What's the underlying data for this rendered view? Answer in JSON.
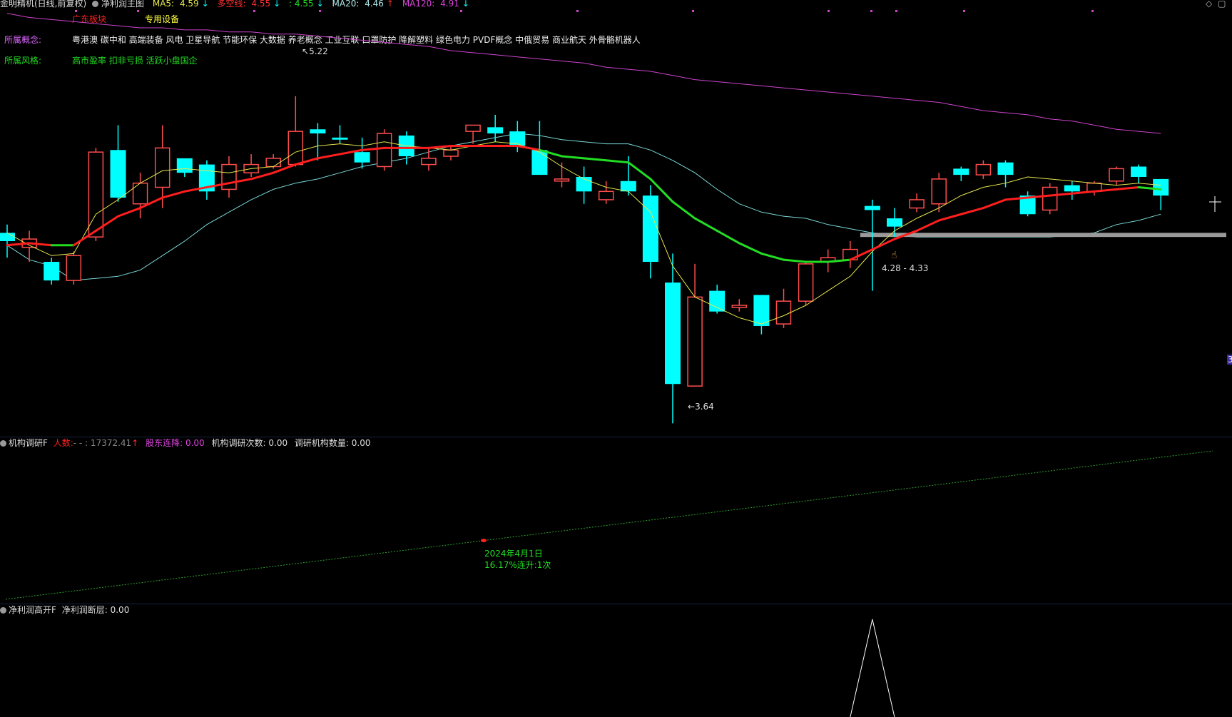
{
  "header": {
    "stock_name": "金明精机(日线,前复权)",
    "indicator": "净利润主图",
    "ma5_label": "MA5:",
    "ma5_value": "4.59",
    "ma5_arrow": "↓",
    "duo_label": "多空线:",
    "duo_value": "4.55",
    "duo_arrow": "↓",
    "colon_value": ": 4.55",
    "colon_arrow": "↓",
    "ma20_label": "MA20:",
    "ma20_value": "4.46",
    "ma20_arrow": "↑",
    "ma120_label": "MA120:",
    "ma120_value": "4.91",
    "ma120_arrow": "↓"
  },
  "info": {
    "region_tag": "广东板块",
    "industry_tag": "专用设备",
    "concept_label": "所属概念:",
    "concepts": "粤港澳  碳中和  高端装备  风电  卫星导航  节能环保  大数据  养老概念  工业互联  口罩防护  降解塑料  绿色电力  PVDF概念  中俄贸易  商业航天  外骨骼机器人",
    "style_label": "所属风格:",
    "styles": "高市盈率  扣非亏损  活跃小盘国企"
  },
  "colors": {
    "up": "#ff4d4d",
    "down": "#00ffff",
    "ma5": "#e6e64d",
    "duo_red": "#ff1e1e",
    "duo_green": "#22dd22",
    "ma20": "#7ad6d6",
    "ma120": "#cc44cc"
  },
  "main_chart_annotations": {
    "high": "5.22",
    "low": "3.64",
    "range": "4.28 - 4.33",
    "edge_marker": "3"
  },
  "panel2": {
    "name": "机构调研F",
    "p1_label": "人数:",
    "p1_value": "- - : 17372.41",
    "p1_arrow": "↑",
    "p2_label": "股东连降:",
    "p2_value": "0.00",
    "p3_label": "机构调研次数:",
    "p3_value": "0.00",
    "p4_label": "调研机构数量:",
    "p4_value": "0.00",
    "event_date": "2024年4月1日",
    "event_text": "16.17%连升:1次"
  },
  "panel3": {
    "name": "净利润高开F",
    "p1_label": "净利润断层:",
    "p1_value": "0.00"
  },
  "chart_data": {
    "type": "candlestick",
    "candles": [
      [
        4.56,
        4.52,
        4.6,
        4.44
      ],
      [
        4.49,
        4.53,
        4.57,
        4.42
      ],
      [
        4.42,
        4.33,
        4.44,
        4.31
      ],
      [
        4.33,
        4.45,
        4.47,
        4.31
      ],
      [
        4.54,
        4.95,
        4.97,
        4.52
      ],
      [
        4.96,
        4.73,
        5.08,
        4.71
      ],
      [
        4.7,
        4.8,
        4.85,
        4.63
      ],
      [
        4.78,
        4.97,
        5.08,
        4.68
      ],
      [
        4.92,
        4.85,
        4.9,
        4.83
      ],
      [
        4.89,
        4.76,
        4.91,
        4.72
      ],
      [
        4.77,
        4.89,
        4.93,
        4.73
      ],
      [
        4.85,
        4.89,
        4.94,
        4.83
      ],
      [
        4.88,
        4.92,
        4.94,
        4.87
      ],
      [
        4.89,
        5.05,
        5.22,
        4.88
      ],
      [
        5.06,
        5.04,
        5.09,
        4.91
      ],
      [
        5.02,
        5.01,
        5.08,
        4.99
      ],
      [
        4.95,
        4.9,
        5.02,
        4.87
      ],
      [
        4.88,
        5.04,
        5.06,
        4.86
      ],
      [
        5.03,
        4.93,
        5.05,
        4.89
      ],
      [
        4.89,
        4.92,
        4.97,
        4.86
      ],
      [
        4.93,
        4.96,
        4.98,
        4.91
      ],
      [
        5.05,
        5.08,
        5.07,
        4.99
      ],
      [
        5.07,
        5.04,
        5.13,
        5.0
      ],
      [
        5.05,
        4.98,
        5.1,
        4.95
      ],
      [
        4.96,
        4.84,
        5.1,
        4.84
      ],
      [
        4.81,
        4.82,
        4.9,
        4.78
      ],
      [
        4.83,
        4.76,
        4.88,
        4.7
      ],
      [
        4.72,
        4.76,
        4.81,
        4.7
      ],
      [
        4.81,
        4.76,
        4.93,
        4.74
      ],
      [
        4.74,
        4.42,
        4.79,
        4.34
      ],
      [
        4.32,
        3.83,
        4.46,
        3.64
      ],
      [
        3.82,
        4.25,
        4.41,
        3.88
      ],
      [
        4.28,
        4.18,
        4.31,
        4.17
      ],
      [
        4.2,
        4.21,
        4.24,
        4.18
      ],
      [
        4.26,
        4.11,
        4.15,
        4.07
      ],
      [
        4.12,
        4.23,
        4.29,
        4.1
      ],
      [
        4.23,
        4.41,
        4.42,
        4.21
      ],
      [
        4.42,
        4.44,
        4.48,
        4.37
      ],
      [
        4.43,
        4.48,
        4.52,
        4.39
      ],
      [
        4.69,
        4.67,
        4.72,
        4.28
      ],
      [
        4.63,
        4.59,
        4.68,
        4.54
      ],
      [
        4.68,
        4.72,
        4.75,
        4.66
      ],
      [
        4.7,
        4.82,
        4.85,
        4.66
      ],
      [
        4.87,
        4.84,
        4.88,
        4.81
      ],
      [
        4.84,
        4.89,
        4.91,
        4.82
      ],
      [
        4.9,
        4.84,
        4.91,
        4.78
      ],
      [
        4.74,
        4.65,
        4.76,
        4.64
      ],
      [
        4.67,
        4.78,
        4.8,
        4.65
      ],
      [
        4.79,
        4.76,
        4.81,
        4.72
      ],
      [
        4.76,
        4.8,
        4.81,
        4.74
      ],
      [
        4.81,
        4.87,
        4.88,
        4.79
      ],
      [
        4.88,
        4.83,
        4.89,
        4.8
      ],
      [
        4.82,
        4.74,
        4.82,
        4.67
      ]
    ],
    "ma5": [
      4.56,
      4.5,
      4.45,
      4.46,
      4.65,
      4.72,
      4.8,
      4.86,
      4.87,
      4.86,
      4.85,
      4.87,
      4.88,
      4.95,
      4.98,
      4.99,
      4.98,
      5.0,
      4.98,
      4.97,
      4.96,
      4.98,
      5.0,
      4.99,
      4.95,
      4.88,
      4.82,
      4.78,
      4.76,
      4.66,
      4.4,
      4.25,
      4.2,
      4.15,
      4.12,
      4.16,
      4.21,
      4.28,
      4.35,
      4.47,
      4.57,
      4.63,
      4.68,
      4.74,
      4.78,
      4.8,
      4.83,
      4.82,
      4.81,
      4.8,
      4.79,
      4.8,
      4.79
    ],
    "duo": [
      4.5,
      4.51,
      4.5,
      4.5,
      4.57,
      4.64,
      4.68,
      4.73,
      4.76,
      4.78,
      4.8,
      4.82,
      4.85,
      4.89,
      4.92,
      4.94,
      4.96,
      4.97,
      4.97,
      4.97,
      4.98,
      4.98,
      4.98,
      4.98,
      4.96,
      4.93,
      4.92,
      4.91,
      4.9,
      4.82,
      4.71,
      4.63,
      4.57,
      4.51,
      4.46,
      4.43,
      4.42,
      4.42,
      4.43,
      4.48,
      4.53,
      4.57,
      4.62,
      4.65,
      4.68,
      4.72,
      4.73,
      4.74,
      4.75,
      4.76,
      4.77,
      4.78,
      4.77
    ],
    "duo_green_segments": [
      [
        2,
        3
      ],
      [
        24,
        38
      ],
      [
        51,
        52
      ]
    ],
    "ma20": [
      4.5,
      4.43,
      4.4,
      4.33,
      4.34,
      4.35,
      4.38,
      4.45,
      4.52,
      4.6,
      4.66,
      4.72,
      4.77,
      4.8,
      4.82,
      4.85,
      4.88,
      4.9,
      4.92,
      4.95,
      4.98,
      5.0,
      5.02,
      5.04,
      5.03,
      5.01,
      5.0,
      4.99,
      4.99,
      4.96,
      4.91,
      4.85,
      4.77,
      4.7,
      4.66,
      4.64,
      4.63,
      4.6,
      4.58,
      4.56,
      4.55,
      4.54,
      4.54,
      4.54,
      4.54,
      4.54,
      4.54,
      4.54,
      4.55,
      4.56,
      4.6,
      4.62,
      4.65
    ],
    "ma120": [
      5.62,
      5.6,
      5.59,
      5.58,
      5.57,
      5.56,
      5.55,
      5.55,
      5.54,
      5.54,
      5.53,
      5.53,
      5.52,
      5.52,
      5.51,
      5.5,
      5.49,
      5.48,
      5.47,
      5.46,
      5.44,
      5.43,
      5.42,
      5.41,
      5.4,
      5.39,
      5.38,
      5.36,
      5.35,
      5.34,
      5.32,
      5.3,
      5.29,
      5.28,
      5.27,
      5.26,
      5.25,
      5.24,
      5.23,
      5.22,
      5.21,
      5.2,
      5.19,
      5.17,
      5.15,
      5.14,
      5.13,
      5.11,
      5.1,
      5.08,
      5.06,
      5.05,
      5.04
    ],
    "zone": [
      4.54,
      4.56
    ],
    "price_range": [
      3.6,
      5.65
    ],
    "panel2_line": {
      "start": 0.0,
      "end": 1.0
    },
    "panel3_spike": {
      "index": 39,
      "value": 1.0
    }
  }
}
